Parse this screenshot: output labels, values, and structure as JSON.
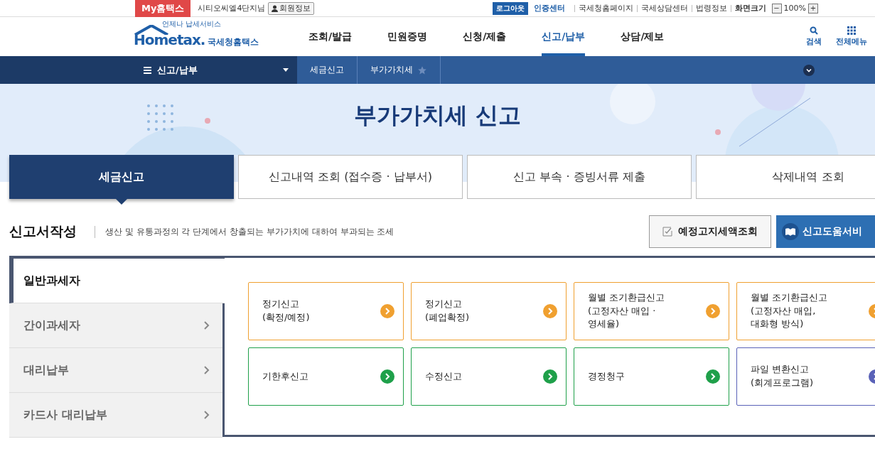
{
  "top_bar": {
    "my_hometax": "My홈택스",
    "user": "시티오씨엘4단지님",
    "member_info": "회원정보",
    "logout": "로그아웃",
    "auth_center": "인증센터",
    "links": [
      "국세청홈페이지",
      "국세상담센터",
      "법령정보"
    ],
    "screen_size_label": "화면크기",
    "zoom_out": "−",
    "zoom": "100%",
    "zoom_in": "+"
  },
  "header": {
    "logo_small": "언제나 납세서비스",
    "logo_main": "Hometax.",
    "logo_sub": "국세청홈택스",
    "nav": [
      {
        "label": "조회/발급",
        "selected": false
      },
      {
        "label": "민원증명",
        "selected": false
      },
      {
        "label": "신청/제출",
        "selected": false
      },
      {
        "label": "신고/납부",
        "selected": true
      },
      {
        "label": "상담/제보",
        "selected": false
      }
    ],
    "search": "검색",
    "all_menu": "전체메뉴"
  },
  "breadcrumb": {
    "menu": "신고/납부",
    "items": [
      "세금신고",
      "부가가치세"
    ],
    "favorite": false
  },
  "hero": {
    "title": "부가가치세 신고"
  },
  "tabs": [
    {
      "label": "세금신고",
      "selected": true
    },
    {
      "label": "신고내역 조회 (접수증 · 납부서)",
      "selected": false
    },
    {
      "label": "신고 부속 · 증빙서류 제출",
      "selected": false
    },
    {
      "label": "삭제내역 조회",
      "selected": false
    }
  ],
  "section": {
    "title": "신고서작성",
    "description": "생산 및 유통과정의 각 단계에서 창출되는 부가가치에 대하여 부과되는 조세",
    "buttons": [
      "예정고지세액조회",
      "신고도움서비"
    ]
  },
  "side_menu": [
    {
      "label": "일반과세자",
      "selected": true
    },
    {
      "label": "간이과세자",
      "selected": false
    },
    {
      "label": "대리납부",
      "selected": false
    },
    {
      "label": "카드사 대리납부",
      "selected": false
    }
  ],
  "cards": [
    {
      "lines": [
        "정기신고",
        "(확정/예정)"
      ],
      "color": "#f0a030"
    },
    {
      "lines": [
        "정기신고",
        "(폐업확정)"
      ],
      "color": "#f0a030"
    },
    {
      "lines": [
        "월별 조기환급신고",
        "(고정자산 매입 ·",
        "영세율)"
      ],
      "color": "#f0a030"
    },
    {
      "lines": [
        "월별 조기환급신고",
        "(고정자산 매입,",
        "대화형 방식)"
      ],
      "color": "#f0a030"
    },
    {
      "lines": [
        "기한후신고"
      ],
      "color": "#1fa04a"
    },
    {
      "lines": [
        "수정신고"
      ],
      "color": "#1fa04a"
    },
    {
      "lines": [
        "경정청구"
      ],
      "color": "#1fa04a"
    },
    {
      "lines": [
        "파일 변환신고",
        "(회계프로그램)"
      ],
      "color": "#5a62b8"
    }
  ]
}
